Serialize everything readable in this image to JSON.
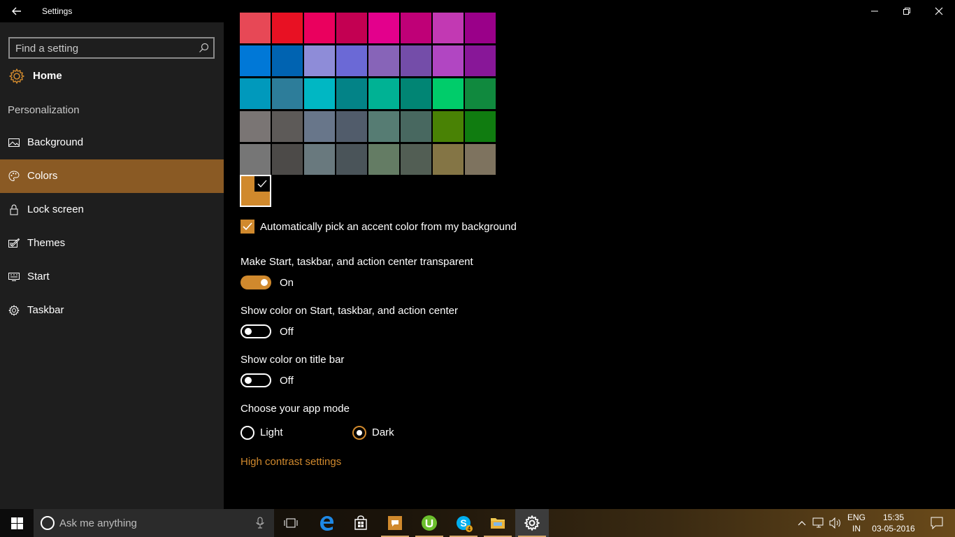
{
  "window": {
    "title": "Settings"
  },
  "sidebar": {
    "search_placeholder": "Find a setting",
    "home_label": "Home",
    "section_label": "Personalization",
    "items": [
      {
        "label": "Background",
        "icon": "picture-icon",
        "active": false
      },
      {
        "label": "Colors",
        "icon": "palette-icon",
        "active": true
      },
      {
        "label": "Lock screen",
        "icon": "lock-icon",
        "active": false
      },
      {
        "label": "Themes",
        "icon": "brush-icon",
        "active": false
      },
      {
        "label": "Start",
        "icon": "start-icon",
        "active": false
      },
      {
        "label": "Taskbar",
        "icon": "gear-icon",
        "active": false
      }
    ]
  },
  "colors": {
    "accent": "#d0892d",
    "palette_rows": [
      [
        "#e74856",
        "#e81123",
        "#ea005e",
        "#c30052",
        "#e3008c",
        "#bf0077",
        "#c239b3",
        "#9a0089"
      ],
      [
        "#0078d7",
        "#0063b1",
        "#8e8cd8",
        "#6b69d6",
        "#8764b8",
        "#744da9",
        "#b146c2",
        "#881798"
      ],
      [
        "#0099bc",
        "#2d7d9a",
        "#00b7c3",
        "#038387",
        "#00b294",
        "#018574",
        "#00cc6a",
        "#10893e"
      ],
      [
        "#7a7574",
        "#5d5a58",
        "#68768a",
        "#515c6b",
        "#567c73",
        "#486860",
        "#498205",
        "#107c10"
      ],
      [
        "#767676",
        "#4c4a48",
        "#69797e",
        "#4a5459",
        "#647c64",
        "#525e54",
        "#847545",
        "#7e735f"
      ]
    ],
    "selected_color": "#d0892d"
  },
  "main": {
    "auto_pick_label": "Automatically pick an accent color from my background",
    "auto_pick_checked": true,
    "transparent_label": "Make Start, taskbar, and action center transparent",
    "transparent_state": "On",
    "show_color_start_label": "Show color on Start, taskbar, and action center",
    "show_color_start_state": "Off",
    "show_color_title_label": "Show color on title bar",
    "show_color_title_state": "Off",
    "app_mode_label": "Choose your app mode",
    "app_mode_options": [
      "Light",
      "Dark"
    ],
    "app_mode_selected": "Dark",
    "high_contrast_link": "High contrast settings"
  },
  "taskbar": {
    "search_placeholder": "Ask me anything",
    "skype_badge": "4",
    "language_line1": "ENG",
    "language_line2": "IN",
    "time": "15:35",
    "date": "03-05-2016"
  }
}
